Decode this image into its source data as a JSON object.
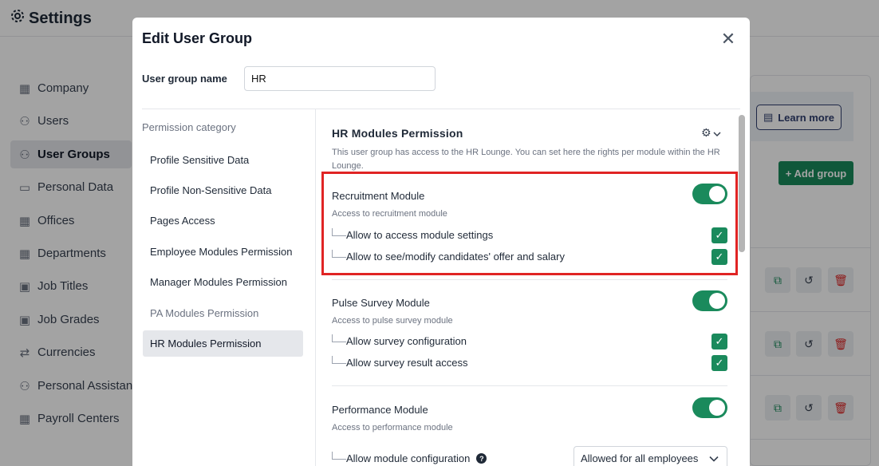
{
  "app": {
    "title": "Settings",
    "sidebar": [
      {
        "label": "Company",
        "icon": "building-icon"
      },
      {
        "label": "Users",
        "icon": "users-icon"
      },
      {
        "label": "User Groups",
        "icon": "users-icon",
        "active": true
      },
      {
        "label": "Personal Data",
        "icon": "id-card-icon"
      },
      {
        "label": "Offices",
        "icon": "building-icon"
      },
      {
        "label": "Departments",
        "icon": "building-icon"
      },
      {
        "label": "Job Titles",
        "icon": "briefcase-icon"
      },
      {
        "label": "Job Grades",
        "icon": "briefcase-icon"
      },
      {
        "label": "Currencies",
        "icon": "exchange-icon"
      },
      {
        "label": "Personal Assistant",
        "icon": "users-icon"
      },
      {
        "label": "Payroll Centers",
        "icon": "building-icon"
      }
    ],
    "learn_more": "Learn more",
    "add_group": "+ Add group"
  },
  "modal": {
    "title": "Edit User Group",
    "name_label": "User group name",
    "name_value": "HR",
    "category_header": "Permission category",
    "categories": [
      {
        "label": "Profile Sensitive Data"
      },
      {
        "label": "Profile Non-Sensitive Data"
      },
      {
        "label": "Pages Access"
      },
      {
        "label": "Employee Modules Permission"
      },
      {
        "label": "Manager Modules Permission"
      },
      {
        "label": "PA Modules Permission",
        "muted": true
      },
      {
        "label": "HR Modules Permission",
        "active": true
      }
    ],
    "section": {
      "title": "HR Modules Permission",
      "description": "This user group has access to the HR Lounge. You can set here the rights per module within the HR Lounge."
    },
    "modules": [
      {
        "name": "Recruitment Module",
        "description": "Access to recruitment module",
        "enabled": true,
        "permissions": [
          {
            "label": "Allow to access module settings",
            "checked": true
          },
          {
            "label": "Allow to see/modify candidates' offer and salary",
            "checked": true
          }
        ]
      },
      {
        "name": "Pulse Survey Module",
        "description": "Access to pulse survey module",
        "enabled": true,
        "permissions": [
          {
            "label": "Allow survey configuration",
            "checked": true
          },
          {
            "label": "Allow survey result access",
            "checked": true
          }
        ]
      },
      {
        "name": "Performance Module",
        "description": "Access to performance module",
        "enabled": true,
        "permissions": [
          {
            "label": "Allow module configuration",
            "select_value": "Allowed for all employees"
          }
        ]
      }
    ]
  },
  "colors": {
    "accent": "#1a8a5c",
    "highlight": "#e02424"
  }
}
